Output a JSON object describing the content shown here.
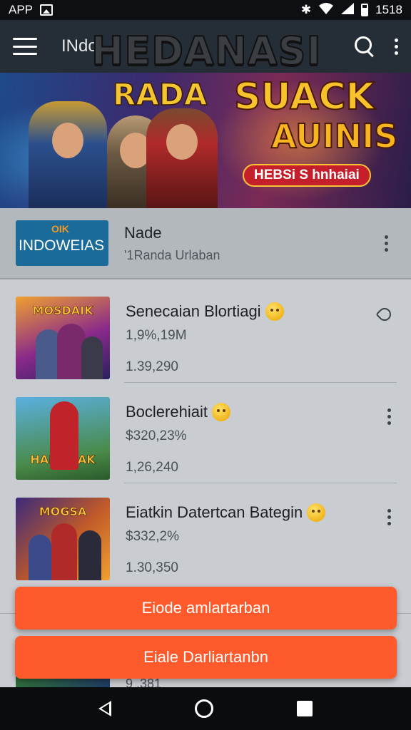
{
  "status_bar": {
    "app_label": "APP",
    "time": "1518"
  },
  "app_bar": {
    "title": "INdo"
  },
  "banner": {
    "big_title": "HEDANASI",
    "left_text": "RADA",
    "right_line1": "SUACK",
    "right_line2": "AUINIS",
    "tag": "HEBSi S hnhaiai"
  },
  "featured": {
    "thumb_tag": "OIK",
    "thumb_text": "INDOWEIAS",
    "name": "Nade",
    "subtitle": "'1Randa Urlaban"
  },
  "items": [
    {
      "thumb_label": "MOSDAIK",
      "title": "Senecaian Blortiagi",
      "meta": "1,9%,19M",
      "count": "1.39,290",
      "action_icon": "pin-icon"
    },
    {
      "thumb_label": "HANSMAK",
      "title": "Boclerehiait",
      "meta": "$320,23%",
      "count": "1,26,240",
      "action_icon": "kebab-icon"
    },
    {
      "thumb_label": "MOGSA",
      "title": "Eiatkin Datertcan Bategin",
      "meta": "$332,2%",
      "count": "1.30,350",
      "action_icon": "kebab-icon"
    }
  ],
  "peek": {
    "text": "9 .381"
  },
  "buttons": {
    "primary": "Eiode amlartarban",
    "secondary": "Eiale Darliartanbn"
  },
  "colors": {
    "accent": "#ff5a2b",
    "app_bar": "#252d36",
    "banner_yellow": "#f7c22b"
  }
}
